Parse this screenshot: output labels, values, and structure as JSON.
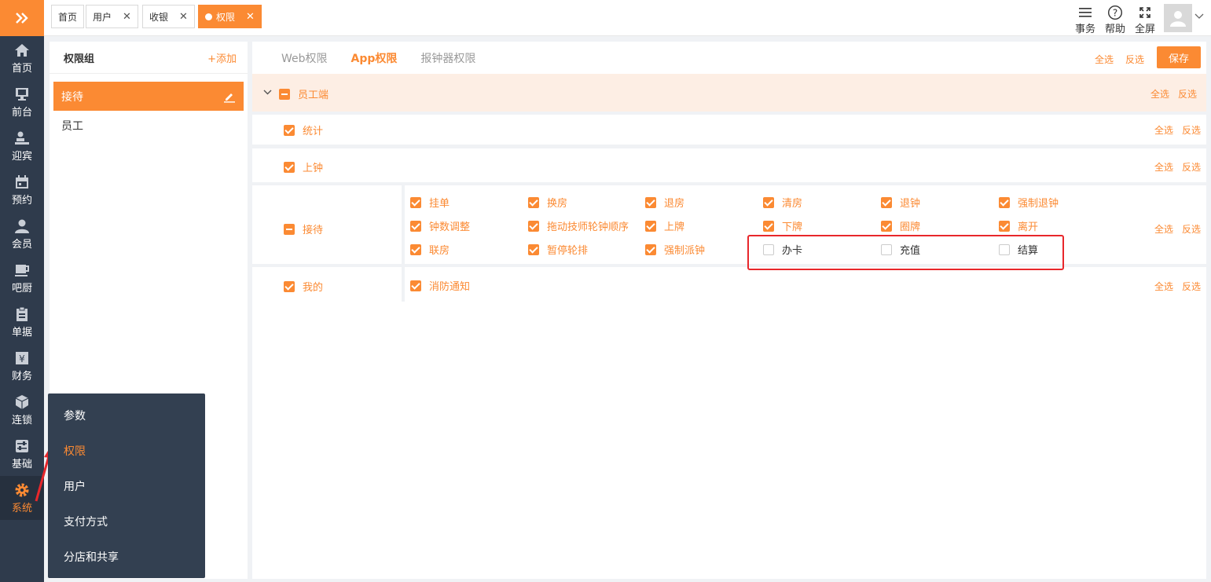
{
  "sidebar": {
    "items": [
      {
        "label": "首页",
        "icon": "home-icon"
      },
      {
        "label": "前台",
        "icon": "monitor-icon"
      },
      {
        "label": "迎宾",
        "icon": "reception-icon"
      },
      {
        "label": "预约",
        "icon": "calendar-icon"
      },
      {
        "label": "会员",
        "icon": "user-icon"
      },
      {
        "label": "吧厨",
        "icon": "cup-icon"
      },
      {
        "label": "单据",
        "icon": "clipboard-icon"
      },
      {
        "label": "财务",
        "icon": "finance-icon"
      },
      {
        "label": "连锁",
        "icon": "cube-icon"
      },
      {
        "label": "基础",
        "icon": "sliders-icon"
      },
      {
        "label": "系统",
        "icon": "gear-icon"
      }
    ]
  },
  "tabs": [
    {
      "label": "首页"
    },
    {
      "label": "用户"
    },
    {
      "label": "收银"
    },
    {
      "label": "权限"
    }
  ],
  "toolbar": {
    "tasks": "事务",
    "help": "帮助",
    "fullscreen": "全屏"
  },
  "group_panel": {
    "title": "权限组",
    "add": "+添加",
    "items": [
      "接待",
      "员工"
    ]
  },
  "submenu": {
    "items": [
      "参数",
      "权限",
      "用户",
      "支付方式",
      "分店和共享"
    ]
  },
  "main": {
    "tabs": [
      "Web权限",
      "App权限",
      "报钟器权限"
    ],
    "select_all": "全选",
    "invert": "反选",
    "save": "保存",
    "section": "员工端",
    "rows": {
      "stats": "统计",
      "clock_in": "上钟",
      "reception": {
        "label": "接待",
        "items": [
          "挂单",
          "换房",
          "退房",
          "清房",
          "退钟",
          "强制退钟",
          "钟数调整",
          "拖动技师轮钟顺序",
          "上牌",
          "下牌",
          "圈牌",
          "离开",
          "联房",
          "暂停轮排",
          "强制派钟",
          "办卡",
          "充值",
          "结算"
        ]
      },
      "mine": {
        "label": "我的",
        "items": [
          "消防通知"
        ]
      }
    }
  },
  "colors": {
    "accent": "#fb8a33",
    "sidebar": "#2f3b4c",
    "highlight": "#e8272b"
  }
}
